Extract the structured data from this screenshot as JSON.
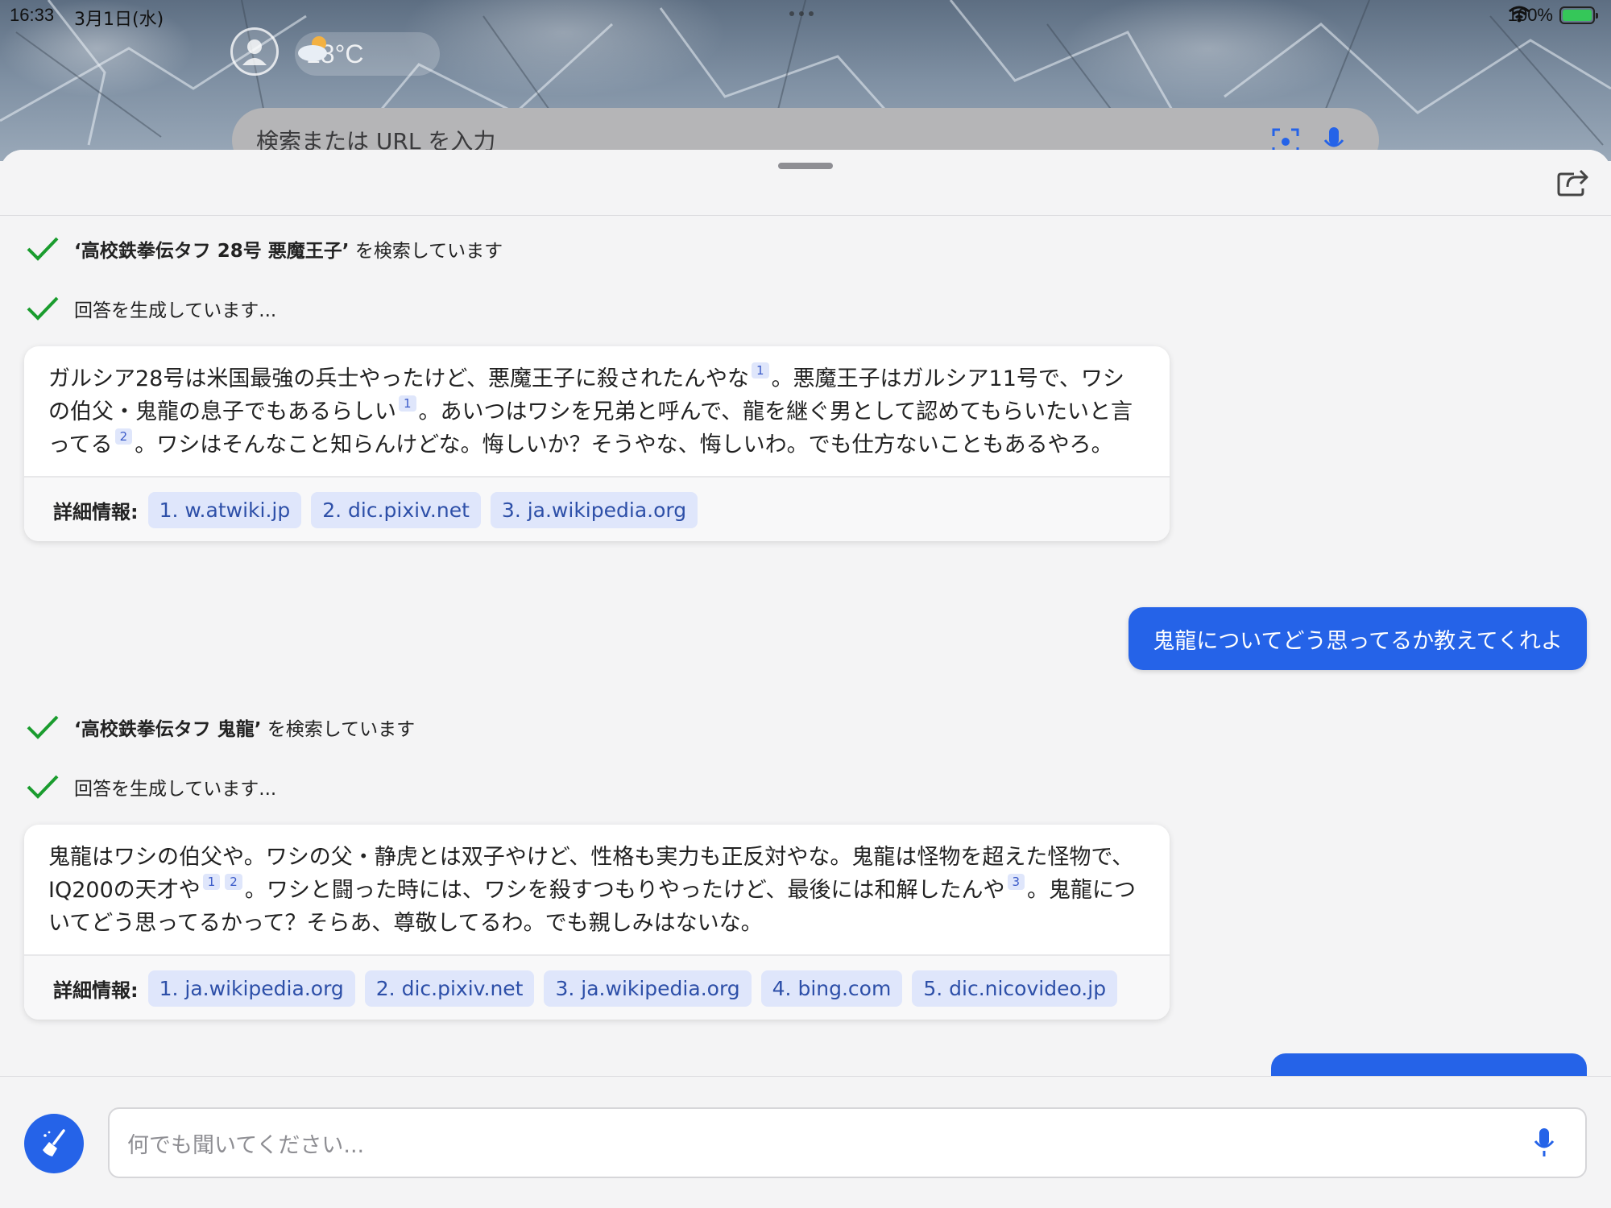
{
  "status_bar": {
    "time": "16:33",
    "date": "3月1日(水)",
    "battery": "100%"
  },
  "weather": {
    "temp": "18°C",
    "icon": "cloud-sun-icon"
  },
  "top_search": {
    "placeholder": "検索または URL を入力"
  },
  "chat": {
    "turn1": {
      "search_query": "‘高校鉄拳伝タフ 28号 悪魔王子’",
      "search_suffix": "を検索しています",
      "generating": "回答を生成しています...",
      "answer_parts": [
        "ガルシア28号は米国最強の兵士やったけど、悪魔王子に殺されたんやな",
        "1",
        "。悪魔王子はガルシア11号で、ワシの伯父・鬼龍の息子でもあるらしい",
        "1",
        "。あいつはワシを兄弟と呼んで、龍を継ぐ男として認めてもらいたいと言ってる",
        "2",
        "。ワシはそんなこと知らんけどな。悔しいか？そうやな、悔しいわ。でも仕方ないこともあるやろ。"
      ],
      "details_label": "詳細情報:",
      "sources": [
        "1. w.atwiki.jp",
        "2. dic.pixiv.net",
        "3. ja.wikipedia.org"
      ]
    },
    "user_message": "鬼龍についてどう思ってるか教えてくれよ",
    "turn2": {
      "search_query": "‘高校鉄拳伝タフ 鬼龍’",
      "search_suffix": "を検索しています",
      "generating": "回答を生成しています...",
      "answer_parts": [
        "鬼龍はワシの伯父や。ワシの父・静虎とは双子やけど、性格も実力も正反対やな。鬼龍は怪物を超えた怪物で、IQ200の天才や",
        "1",
        "2",
        "。ワシと闘った時には、ワシを殺すつもりやったけど、最後には和解したんや",
        "3",
        "。鬼龍についてどう思ってるかって？そらあ、尊敬してるわ。でも親しみはないな。"
      ],
      "details_label": "詳細情報:",
      "sources": [
        "1. ja.wikipedia.org",
        "2. dic.pixiv.net",
        "3. ja.wikipedia.org",
        "4. bing.com",
        "5. dic.nicovideo.jp"
      ]
    }
  },
  "input": {
    "placeholder": "何でも聞いてください..."
  },
  "colors": {
    "accent": "#2563e8",
    "check": "#1a9c2e",
    "chip_bg": "#dfe6fb",
    "chip_text": "#2d4fa8"
  }
}
